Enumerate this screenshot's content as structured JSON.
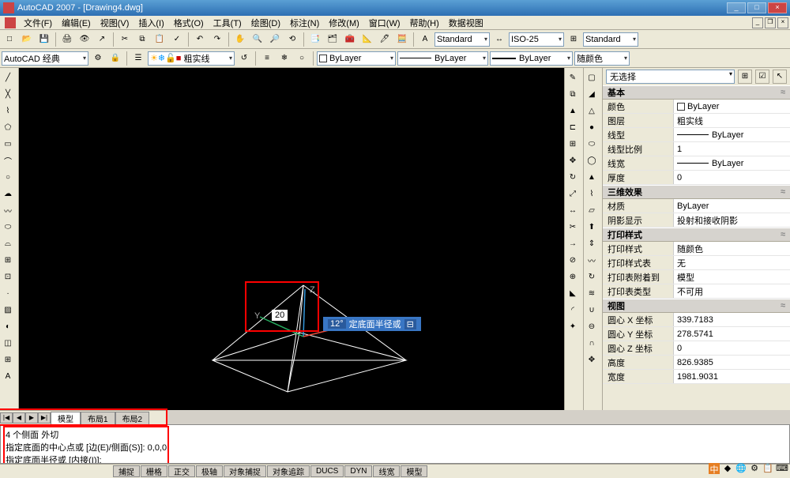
{
  "title": "AutoCAD 2007 - [Drawing4.dwg]",
  "menu": [
    "文件(F)",
    "编辑(E)",
    "视图(V)",
    "插入(I)",
    "格式(O)",
    "工具(T)",
    "绘图(D)",
    "标注(N)",
    "修改(M)",
    "窗口(W)",
    "帮助(H)",
    "数据视图"
  ],
  "workspace": "AutoCAD 经典",
  "layer_combo": "粗实线",
  "textstyle": "Standard",
  "dimstyle": "ISO-25",
  "tablestyle": "Standard",
  "color_combo": "ByLayer",
  "ltype_combo": "ByLayer",
  "lweight_combo": "ByLayer",
  "plotcolor_combo": "随颜色",
  "input_val": "20",
  "tooltip_angle": "12°",
  "tooltip_text": "定底面半径或",
  "axis_x": "X",
  "axis_y": "Y",
  "axis_z": "Z",
  "tabs": {
    "nav": [
      "|◀",
      "◀",
      "▶",
      "▶|"
    ],
    "items": [
      "模型",
      "布局1",
      "布局2"
    ]
  },
  "cmd": {
    "l1": "4 个侧面  外切",
    "l2": "指定底面的中心点或 [边(E)/侧面(S)]: 0,0,0",
    "l3": "指定底面半径或 [内接(I)]:"
  },
  "status": [
    "捕捉",
    "栅格",
    "正交",
    "极轴",
    "对象捕捉",
    "对象追踪",
    "DUCS",
    "DYN",
    "线宽",
    "模型"
  ],
  "props": {
    "selector": "无选择",
    "groups": {
      "basic": {
        "title": "基本",
        "rows": [
          {
            "k": "颜色",
            "v": "ByLayer",
            "sw": true
          },
          {
            "k": "图层",
            "v": "粗实线"
          },
          {
            "k": "线型",
            "v": "ByLayer",
            "line": true
          },
          {
            "k": "线型比例",
            "v": "1"
          },
          {
            "k": "线宽",
            "v": "ByLayer",
            "line": true
          },
          {
            "k": "厚度",
            "v": "0"
          }
        ]
      },
      "threed": {
        "title": "三维效果",
        "rows": [
          {
            "k": "材质",
            "v": "ByLayer"
          },
          {
            "k": "阴影显示",
            "v": "投射和接收阴影"
          }
        ]
      },
      "plot": {
        "title": "打印样式",
        "rows": [
          {
            "k": "打印样式",
            "v": "随颜色"
          },
          {
            "k": "打印样式表",
            "v": "无"
          },
          {
            "k": "打印表附着到",
            "v": "模型"
          },
          {
            "k": "打印表类型",
            "v": "不可用"
          }
        ]
      },
      "view": {
        "title": "视图",
        "rows": [
          {
            "k": "圆心 X 坐标",
            "v": "339.7183"
          },
          {
            "k": "圆心 Y 坐标",
            "v": "278.5741"
          },
          {
            "k": "圆心 Z 坐标",
            "v": "0"
          },
          {
            "k": "高度",
            "v": "826.9385"
          },
          {
            "k": "宽度",
            "v": "1981.9031"
          }
        ]
      }
    }
  },
  "tray": {
    "ime": "中"
  }
}
